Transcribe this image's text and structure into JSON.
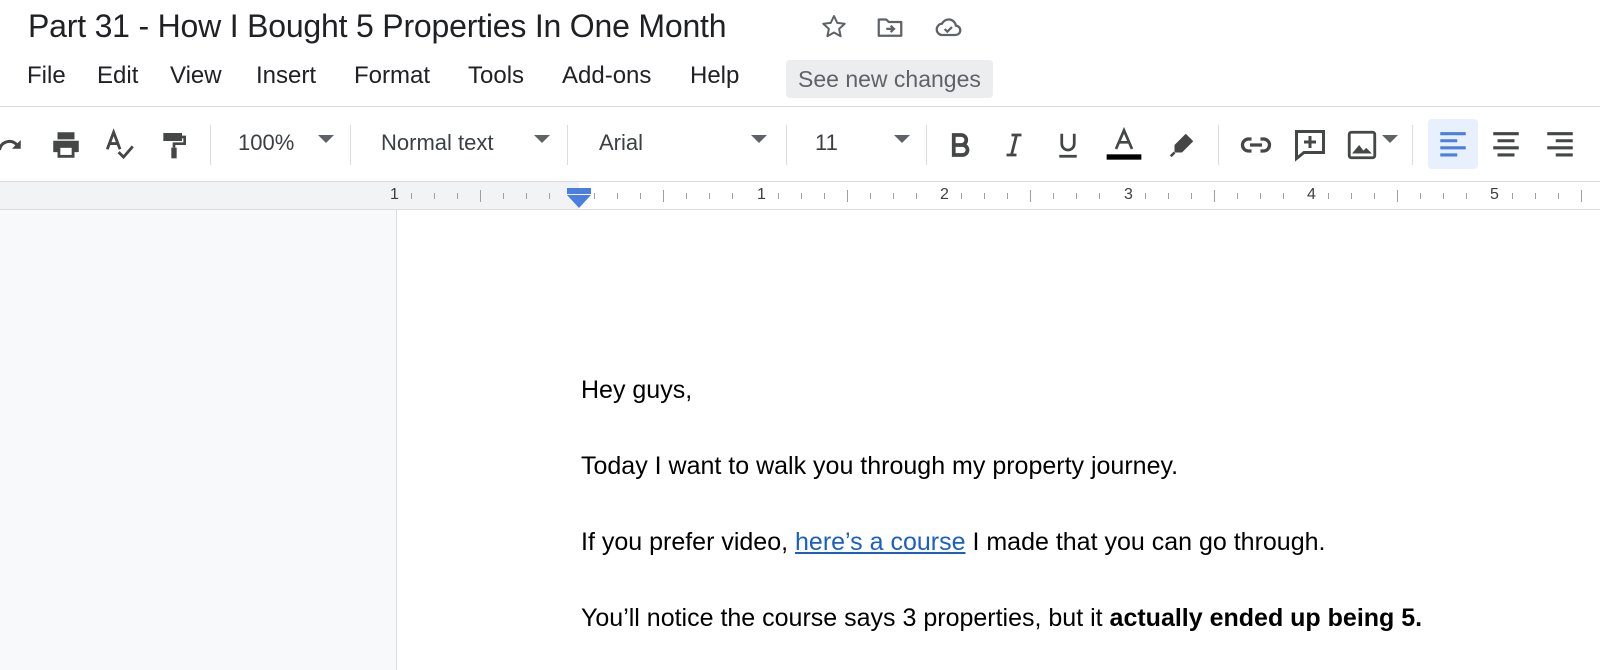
{
  "app": {
    "doc_title": "Part 31 - How I Bought 5 Properties In One Month",
    "title_icons": [
      "star-icon",
      "move-to-folder-icon",
      "cloud-saved-icon"
    ]
  },
  "menu": {
    "items": [
      "File",
      "Edit",
      "View",
      "Insert",
      "Format",
      "Tools",
      "Add-ons",
      "Help"
    ],
    "see_new_changes": "See new changes"
  },
  "toolbar": {
    "zoom": "100%",
    "style": "Normal text",
    "font": "Arial",
    "font_size": "11",
    "text_color": "#000000",
    "active_alignment": "align-left",
    "icons": [
      "redo-icon",
      "print-icon",
      "spellcheck-icon",
      "paint-format-icon",
      "bold-icon",
      "italic-icon",
      "underline-icon",
      "text-color-icon",
      "highlight-icon",
      "link-icon",
      "add-comment-icon",
      "insert-image-icon",
      "align-left-icon",
      "align-center-icon",
      "align-right-icon"
    ]
  },
  "ruler": {
    "labels": [
      "1",
      "1",
      "2",
      "3",
      "4",
      "5"
    ]
  },
  "document": {
    "greeting": "Hey guys,",
    "p1": "Today I want to walk you through my property journey.",
    "p2_before": "If you prefer video, ",
    "p2_link": "here’s a course",
    "p2_after": " I made that you can go through.",
    "p3_normal": "You’ll notice the course says 3 properties, but it ",
    "p3_bold": "actually ended up being 5."
  },
  "colors": {
    "link": "#1a5fc4",
    "accent": "#4a7fe0",
    "active_bg": "#e8f0fe"
  }
}
